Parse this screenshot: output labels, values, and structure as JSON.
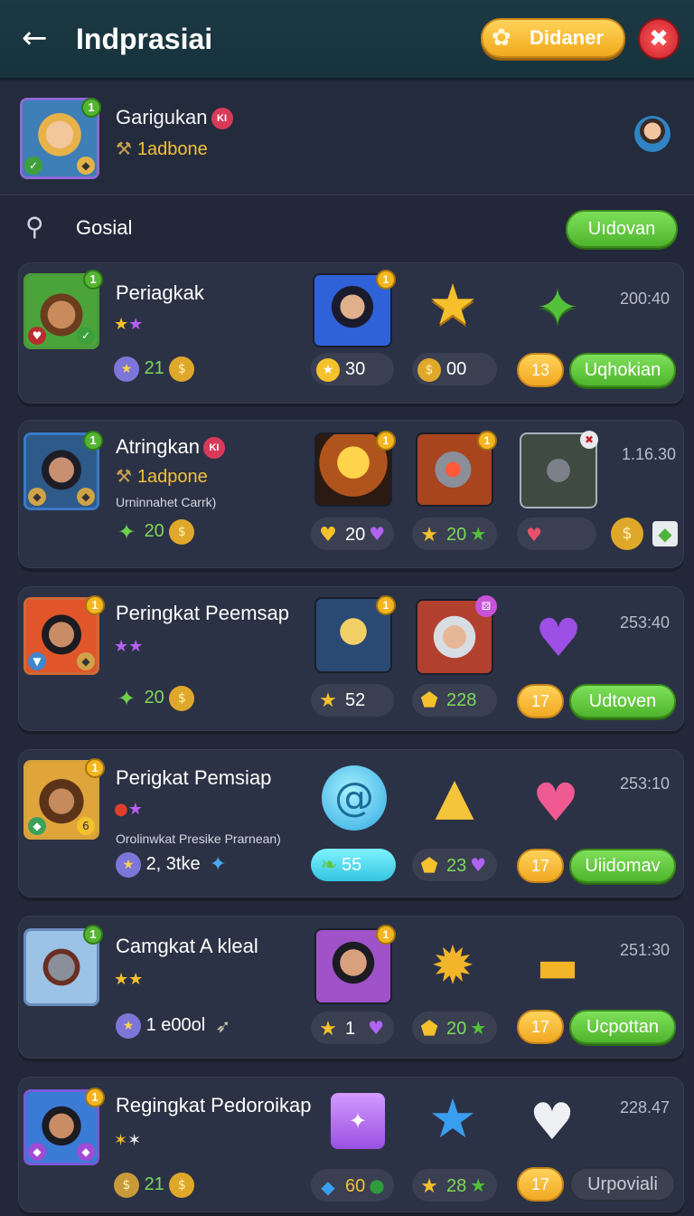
{
  "header": {
    "title": "Indprasiai",
    "back_icon": "back-arrow-icon",
    "action_label": "Didaner",
    "close_icon": "close-icon"
  },
  "profile": {
    "name": "Garigukan",
    "tag": "KI",
    "currency": "1adbone"
  },
  "search": {
    "label": "Gosial",
    "button": "Uıdovan"
  },
  "colors": {
    "gold": "#f2c23a",
    "green": "#5cc536",
    "background": "#23273a",
    "card": "#2c3245"
  },
  "rows": [
    {
      "name": "Periagkak",
      "tag": "",
      "subtitle": "",
      "currency": "",
      "coins": "21",
      "pill1": "30",
      "pill2": "00",
      "time": "200:40",
      "count": "13",
      "button": "Uqhokian"
    },
    {
      "name": "Atringkan",
      "tag": "KI",
      "subtitle": "Urninnahet Carrk)",
      "currency": "1adpone",
      "coins": "20",
      "pill1": "20",
      "pill2": "20",
      "time": "1.16.30",
      "count": "",
      "button": ""
    },
    {
      "name": "Peringkat Peemsap",
      "tag": "",
      "subtitle": "",
      "currency": "",
      "coins": "20",
      "pill1": "52",
      "pill2": "228",
      "time": "253:40",
      "count": "17",
      "button": "Udtoven"
    },
    {
      "name": "Perigkat Pemsiap",
      "tag": "",
      "subtitle": "Orolinwkat Presike Prarnean)",
      "currency": "",
      "coins": "2, 3tke",
      "pill1": "55",
      "pill2": "23",
      "time": "253:10",
      "count": "17",
      "button": "Uiidomav"
    },
    {
      "name": "Camgkat A kleal",
      "tag": "",
      "subtitle": "",
      "currency": "",
      "coins": "1 e00ol",
      "pill1": "1",
      "pill2": "20",
      "time": "251:30",
      "count": "17",
      "button": "Ucpottan"
    },
    {
      "name": "Regingkat Pedoroikap",
      "tag": "",
      "subtitle": "",
      "currency": "",
      "coins": "21",
      "pill1": "60",
      "pill2": "28",
      "time": "228.47",
      "count": "17",
      "button": "Urpoviali"
    }
  ],
  "badge_value": "1"
}
